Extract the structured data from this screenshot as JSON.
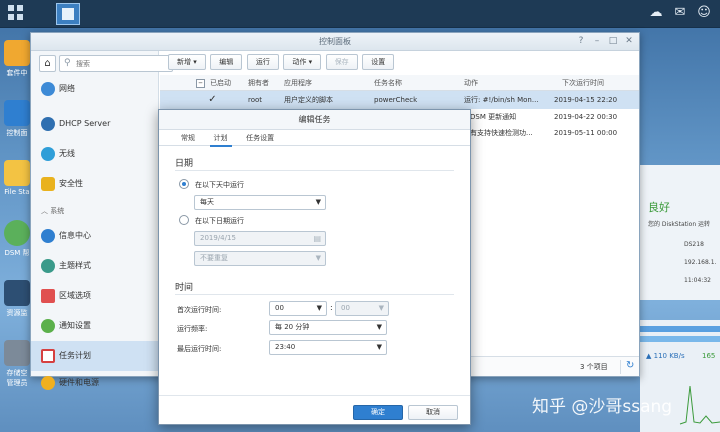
{
  "control_panel": {
    "title": "控制面板",
    "search_placeholder": "搜索",
    "sidebar": {
      "items_top": [
        {
          "label": "网络",
          "icon": "network-icon"
        },
        {
          "label": "DHCP Server",
          "icon": "dhcp-icon"
        },
        {
          "label": "无线",
          "icon": "wifi-icon"
        },
        {
          "label": "安全性",
          "icon": "shield-icon"
        }
      ],
      "group_label": "系统",
      "items_bottom": [
        {
          "label": "信息中心",
          "icon": "info-icon"
        },
        {
          "label": "主题样式",
          "icon": "palette-icon"
        },
        {
          "label": "区域选项",
          "icon": "calendar-icon"
        },
        {
          "label": "通知设置",
          "icon": "chat-icon"
        },
        {
          "label": "任务计划",
          "icon": "task-icon"
        },
        {
          "label": "硬件和电源",
          "icon": "bulb-icon"
        }
      ]
    },
    "toolbar": {
      "new_label": "新增",
      "edit_label": "编辑",
      "run_label": "运行",
      "action_label": "动作",
      "save_label": "保存",
      "settings_label": "设置"
    },
    "table": {
      "headers": {
        "enabled": "已启动",
        "owner": "拥有者",
        "app": "应用程序",
        "task": "任务名称",
        "action": "动作",
        "next_run": "下次运行时间"
      },
      "rows": [
        {
          "owner": "root",
          "app": "用户定义的脚本",
          "task": "powerCheck",
          "action": "运行: #!/bin/sh Mon...",
          "next_run": "2019-04-15 22:20"
        },
        {
          "owner": "",
          "app": "",
          "task": "",
          "action": "DSM 更新通知",
          "next_run": "2019-04-22 00:30"
        },
        {
          "owner": "",
          "app": "",
          "task": "",
          "action": "有支持快速检测功...",
          "next_run": "2019-05-11 00:00"
        }
      ],
      "footer_count": "3 个项目"
    }
  },
  "widget": {
    "status": "良好",
    "message": "您的 DiskStation 运转",
    "model": "DS218",
    "ip": "192.168.1.",
    "time": "11:04:32",
    "speed_in": "110 KB/s",
    "speed_out": "165"
  },
  "desktop": {
    "icons": [
      "套件中",
      "控制面",
      "File Sta",
      "DSM 帮",
      "资源监",
      "存储空\n管理员"
    ]
  },
  "dialog": {
    "title": "编辑任务",
    "tabs": [
      "常规",
      "计划",
      "任务设置"
    ],
    "active_tab": 1,
    "date_section": "日期",
    "radio_days_label": "在以下天中运行",
    "days_value": "每天",
    "radio_date_label": "在以下日期运行",
    "date_value": "2019/4/15",
    "repeat_value": "不要重复",
    "time_section": "时间",
    "first_run_label": "首次运行时间:",
    "first_run_hour": "00",
    "first_run_minute": "00",
    "frequency_label": "运行频率:",
    "frequency_value": "每 20 分钟",
    "last_run_label": "最后运行时间:",
    "last_run_value": "23:40",
    "ok_label": "确定",
    "cancel_label": "取消"
  },
  "watermark": "知乎 @沙哥ssang"
}
